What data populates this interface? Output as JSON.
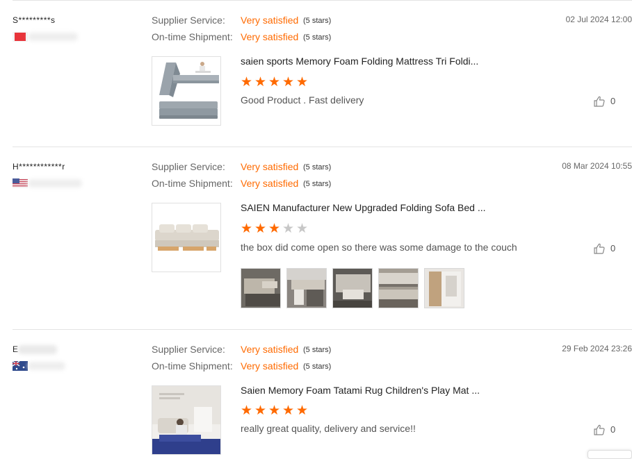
{
  "colors": {
    "accent": "#ff6a00",
    "star_off": "#c7c7c7"
  },
  "reviews": [
    {
      "user": "S*********s",
      "country_flag": "flag-red",
      "supplier_service_label": "Supplier Service:",
      "supplier_service_value": "Very satisfied",
      "supplier_service_stars": "(5 stars)",
      "shipment_label": "On-time Shipment:",
      "shipment_value": "Very satisfied",
      "shipment_stars": "(5 stars)",
      "date": "02 Jul 2024 12:00",
      "product_title": "saien sports Memory Foam Folding Mattress Tri Foldi...",
      "rating": 5,
      "comment": "Good Product . Fast delivery",
      "likes": "0"
    },
    {
      "user": "H************r",
      "country_flag": "flag-us",
      "supplier_service_label": "Supplier Service:",
      "supplier_service_value": "Very satisfied",
      "supplier_service_stars": "(5 stars)",
      "shipment_label": "On-time Shipment:",
      "shipment_value": "Very satisfied",
      "shipment_stars": "(5 stars)",
      "date": "08 Mar 2024 10:55",
      "product_title": "SAIEN Manufacturer New Upgraded Folding Sofa Bed ...",
      "rating": 3,
      "comment": "the box did come open so there was some damage to the couch",
      "likes": "0",
      "photo_count": 5
    },
    {
      "user": "E",
      "country_flag": "flag-au",
      "supplier_service_label": "Supplier Service:",
      "supplier_service_value": "Very satisfied",
      "supplier_service_stars": "(5 stars)",
      "shipment_label": "On-time Shipment:",
      "shipment_value": "Very satisfied",
      "shipment_stars": "(5 stars)",
      "date": "29 Feb 2024 23:26",
      "product_title": "Saien Memory Foam Tatami Rug Children's Play Mat ...",
      "rating": 5,
      "comment": "really great quality, delivery and service!!",
      "likes": "0"
    }
  ]
}
